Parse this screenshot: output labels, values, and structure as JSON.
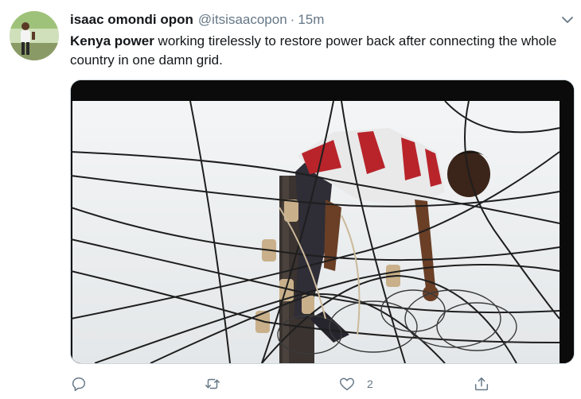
{
  "tweet": {
    "author": {
      "display_name": "isaac omondi opon",
      "handle": "@itsisaacopon",
      "separator": "·",
      "timestamp": "15m"
    },
    "text": {
      "highlight": "Kenya power",
      "rest": " working tirelessly to restore power back after connecting the whole country in one damn grid."
    },
    "media": {
      "kind": "photo"
    },
    "actions": {
      "reply_count": "",
      "retweet_count": "",
      "like_count": "2",
      "share_count": ""
    }
  },
  "colors": {
    "text_primary": "#14171a",
    "text_secondary": "#657786",
    "icon_gray": "#657786",
    "divider": "#ccd6dd"
  },
  "icons": {
    "caret": "chevron-down-icon",
    "reply": "reply-icon",
    "retweet": "retweet-icon",
    "like": "heart-icon",
    "share": "share-icon"
  }
}
